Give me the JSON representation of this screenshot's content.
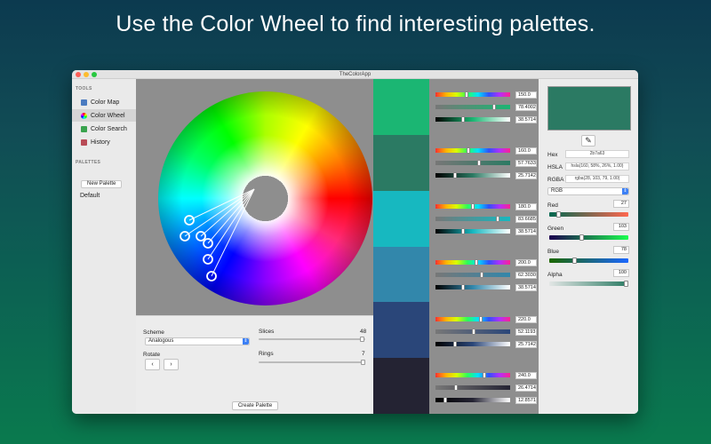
{
  "banner": {
    "text": "Use the Color Wheel to find interesting palettes."
  },
  "window": {
    "title": "TheColorApp"
  },
  "sidebar": {
    "tools_header": "TOOLS",
    "items": [
      {
        "label": "Color Map",
        "icon": "color-map-icon",
        "color": "#4a7bc0"
      },
      {
        "label": "Color Wheel",
        "icon": "color-wheel-icon",
        "color": "#e0704a"
      },
      {
        "label": "Color Search",
        "icon": "color-search-icon",
        "color": "#3aa34e"
      },
      {
        "label": "History",
        "icon": "history-icon",
        "color": "#b84b56"
      }
    ],
    "palettes_header": "PALETTES",
    "new_palette": "New Palette",
    "default_palette": "Default"
  },
  "controls": {
    "scheme_label": "Scheme",
    "scheme_value": "Analogous",
    "rotate_label": "Rotate",
    "rotate_left": "‹",
    "rotate_right": "›",
    "slices_label": "Slices",
    "slices_value": "48",
    "rings_label": "Rings",
    "rings_value": "7",
    "create_palette": "Create Palette"
  },
  "palette": [
    {
      "color": "#1bb673",
      "hue": "150.0",
      "sat": "78.4002",
      "lum": "38.5714"
    },
    {
      "color": "#2b7a63",
      "hue": "160.0",
      "sat": "57.7633",
      "lum": "25.7142"
    },
    {
      "color": "#17b8c0",
      "hue": "180.0",
      "sat": "83.6685",
      "lum": "38.5714"
    },
    {
      "color": "#3287ab",
      "hue": "200.0",
      "sat": "62.3030",
      "lum": "38.5714"
    },
    {
      "color": "#2a4679",
      "hue": "220.0",
      "sat": "52.1193",
      "lum": "25.7142"
    },
    {
      "color": "#242333",
      "hue": "240.0",
      "sat": "26.4714",
      "lum": "12.8571"
    }
  ],
  "inspector": {
    "preview_color": "#2b7a63",
    "eyedropper": "eyedropper-icon",
    "hex_label": "Hex",
    "hex_value": "2b7a63",
    "hsla_label": "HSLA",
    "hsla_value": "hsla(160, 58%, 26%, 1.00)",
    "rgba_label": "RGBA",
    "rgba_value": "rgba(28, 103, 79, 1.00)",
    "mode": "RGB",
    "red_label": "Red",
    "red_value": "27",
    "green_label": "Green",
    "green_value": "103",
    "blue_label": "Blue",
    "blue_value": "78",
    "alpha_label": "Alpha",
    "alpha_value": "100"
  }
}
